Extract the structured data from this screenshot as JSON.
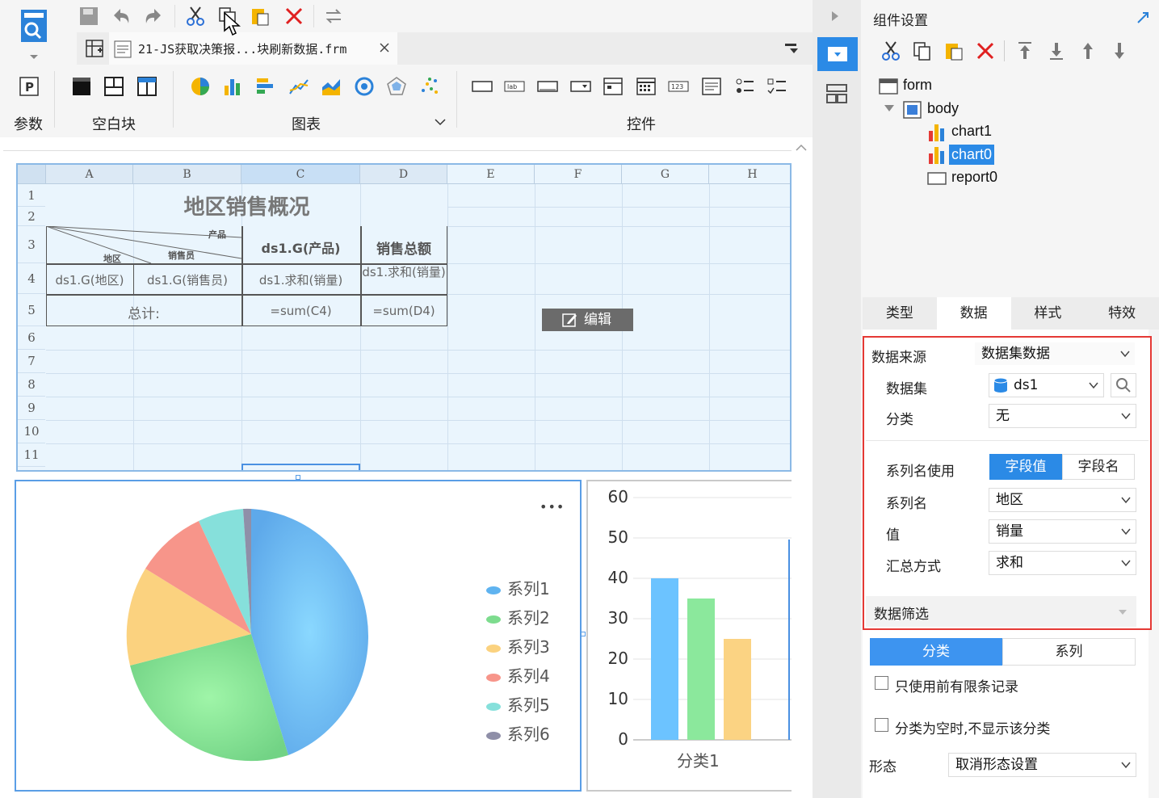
{
  "toolbar": {
    "file_tab": "21-JS获取决策报...块刷新数据.frm",
    "groups": {
      "param": "参数",
      "blank": "空白块",
      "chart": "图表",
      "widget": "控件"
    }
  },
  "sheet": {
    "columns": [
      "A",
      "B",
      "C",
      "D",
      "E",
      "F",
      "G",
      "H"
    ],
    "rows": [
      "1",
      "2",
      "3",
      "4",
      "5",
      "6",
      "7",
      "8",
      "9",
      "10",
      "11"
    ],
    "title": "地区销售概况",
    "diag_product": "产品",
    "diag_seller": "销售员",
    "diag_region": "地区",
    "c3": "ds1.G(产品)",
    "d3": "销售总额",
    "a4": "ds1.G(地区)",
    "b4": "ds1.G(销售员)",
    "c4": "ds1.求和(销量)",
    "d4": "ds1.求和(销量)",
    "a5": "总计:",
    "c5": "=sum(C4)",
    "d5": "=sum(D4)",
    "edit_button": "编辑"
  },
  "pie": {
    "more": "•••",
    "legend": [
      "系列1",
      "系列2",
      "系列3",
      "系列4",
      "系列5",
      "系列6"
    ],
    "colors": [
      "#5fb3f0",
      "#7ddc8e",
      "#fbd27f",
      "#f7958a",
      "#86e0db",
      "#8f8fa8"
    ]
  },
  "chart_data": {
    "type": "bar",
    "categories": [
      "分类1"
    ],
    "series": [
      {
        "values": [
          40
        ],
        "color": "#6cc3ff"
      },
      {
        "values": [
          35
        ],
        "color": "#8be89c"
      },
      {
        "values": [
          25
        ],
        "color": "#fbd383"
      }
    ],
    "yticks": [
      "60",
      "50",
      "40",
      "30",
      "20",
      "10",
      "0"
    ],
    "ylim": [
      0,
      60
    ]
  },
  "panel": {
    "title": "组件设置",
    "tree": {
      "form": "form",
      "body": "body",
      "chart1": "chart1",
      "chart0": "chart0",
      "report0": "report0"
    },
    "tabs": [
      "类型",
      "数据",
      "样式",
      "特效"
    ],
    "data_source_label": "数据来源",
    "data_source_value": "数据集数据",
    "dataset_label": "数据集",
    "dataset_value": "ds1",
    "category_label": "分类",
    "category_value": "无",
    "series_name_use_label": "系列名使用",
    "toggle_field_value": "字段值",
    "toggle_field_name": "字段名",
    "series_name_label": "系列名",
    "series_name_value": "地区",
    "value_label": "值",
    "value_value": "销量",
    "summary_label": "汇总方式",
    "summary_value": "求和",
    "filter_label": "数据筛选",
    "switch_category": "分类",
    "switch_series": "系列",
    "check_top_n": "只使用前有限条记录",
    "check_hide_empty": "分类为空时,不显示该分类",
    "form_label": "形态",
    "form_value": "取消形态设置"
  }
}
